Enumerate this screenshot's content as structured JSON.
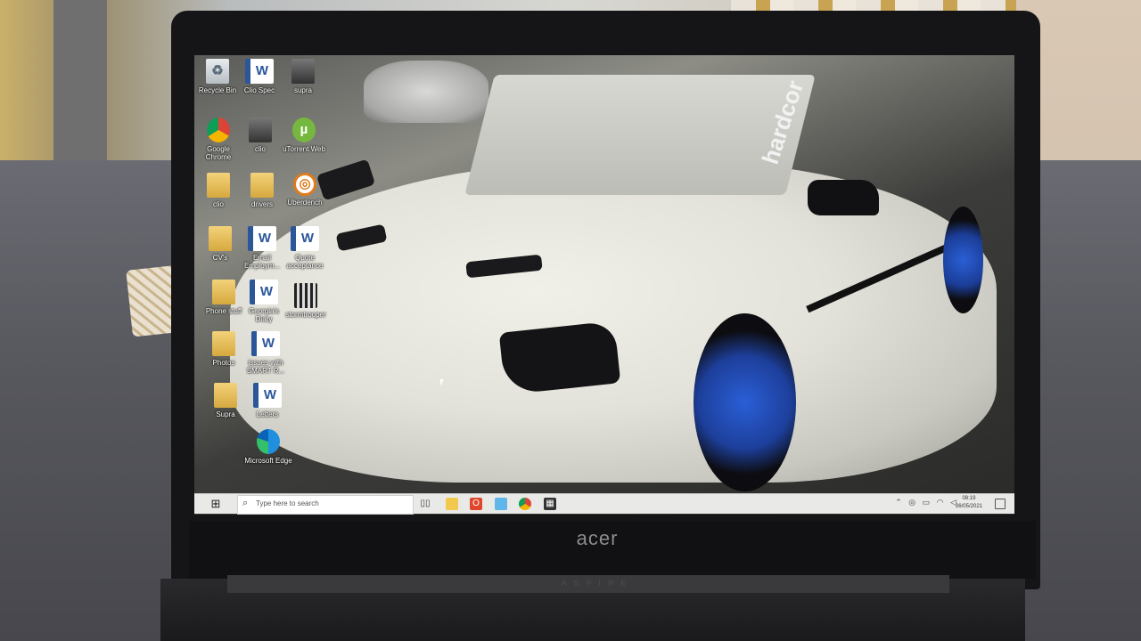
{
  "desktop": {
    "icons": [
      {
        "label": "Recycle Bin",
        "icon": "recycle-bin-icon"
      },
      {
        "label": "Clio Spec",
        "icon": "word-document-icon"
      },
      {
        "label": "supra",
        "icon": "image-file-icon"
      },
      {
        "label": "Google Chrome",
        "icon": "chrome-icon"
      },
      {
        "label": "clio",
        "icon": "image-file-icon"
      },
      {
        "label": "uTorrent Web",
        "icon": "utorrent-icon"
      },
      {
        "label": "clio",
        "icon": "folder-icon"
      },
      {
        "label": "drivers",
        "icon": "folder-icon"
      },
      {
        "label": "Uberdench",
        "icon": "setup-icon"
      },
      {
        "label": "CV's",
        "icon": "folder-icon"
      },
      {
        "label": "Email Employm...",
        "icon": "word-document-icon"
      },
      {
        "label": "Quote acceptance",
        "icon": "word-document-icon"
      },
      {
        "label": "Phone stuff",
        "icon": "folder-icon"
      },
      {
        "label": "Georgia's Diary",
        "icon": "word-document-icon"
      },
      {
        "label": "stormtrooper",
        "icon": "qr-image-icon"
      },
      {
        "label": "Photos",
        "icon": "folder-icon"
      },
      {
        "label": "issues with SMART R...",
        "icon": "word-document-icon"
      },
      {
        "label": "Supra",
        "icon": "folder-icon"
      },
      {
        "label": "Letters",
        "icon": "word-document-icon"
      },
      {
        "label": "Microsoft Edge",
        "icon": "edge-icon"
      }
    ]
  },
  "wallpaper": {
    "windshield_text": "hardcor"
  },
  "taskbar": {
    "search_placeholder": "Type here to search",
    "clock_time": "08:19",
    "clock_date": "26/05/2021",
    "pinned": [
      "task-view-icon",
      "file-explorer-icon",
      "office-icon",
      "photos-icon",
      "chrome-icon",
      "calculator-icon"
    ]
  },
  "laptop": {
    "brand": "acer",
    "model": "ASPIRE"
  }
}
